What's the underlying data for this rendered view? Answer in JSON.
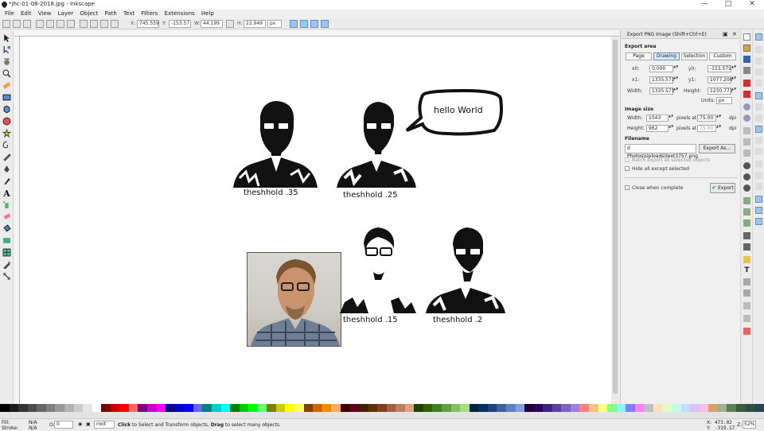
{
  "window": {
    "title": "*jhc-01-08-2018.jpg - Inkscape",
    "min": "—",
    "max": "□",
    "close": "✕"
  },
  "menu": [
    "File",
    "Edit",
    "View",
    "Layer",
    "Object",
    "Path",
    "Text",
    "Filters",
    "Extensions",
    "Help"
  ],
  "toolbar": {
    "x_label": "X:",
    "x_value": "745.559",
    "y_label": "Y:",
    "y_value": "-153.57",
    "w_label": "W:",
    "w_value": "44.199",
    "h_label": "H:",
    "h_value": "22.949",
    "unit": "px"
  },
  "canvas": {
    "labels": [
      "theshhold .35",
      "theshhold .25",
      "theshhold .15",
      "theshhold .2"
    ],
    "bubble_text": "hello World"
  },
  "export_dialog": {
    "title": "Export PNG Image (Shift+Ctrl+E)",
    "export_area_label": "Export area",
    "tabs": [
      "Page",
      "Drawing",
      "Selection",
      "Custom"
    ],
    "active_tab": "Drawing",
    "x0_label": "x0:",
    "x0": "0.000",
    "y0_label": "y0:",
    "y0": "-153.571",
    "x1_label": "x1:",
    "x1": "1335.571",
    "y1_label": "y1:",
    "y1": "1077.200",
    "width_label": "Width:",
    "width": "1335.571",
    "height_label": "Height:",
    "height": "1230.771",
    "units_label": "Units:",
    "units": "px",
    "image_size_label": "Image size",
    "img_width_label": "Width:",
    "img_width": "1043",
    "img_height_label": "Height:",
    "img_height": "962",
    "pixels_at": "pixels at",
    "dpi_value": "75.00",
    "dpi_value_disabled": "75.00",
    "dpi": "dpi",
    "filename_label": "Filename",
    "filename": "d Photos\\Uploads\\text3757.png",
    "export_as": "Export As...",
    "batch_label": "Batch export all selected objects",
    "hide_label": "Hide all except selected",
    "close_label": "Close when complete",
    "export_button": "Export"
  },
  "status": {
    "fill_label": "Fill:",
    "fill_value": "N/A",
    "stroke_label": "Stroke:",
    "stroke_value": "N/A",
    "opacity_label": "O:",
    "opacity_value": "0",
    "layer": "root",
    "message_bold1": "Click",
    "message1": " to Select and Transform objects, ",
    "message_bold2": "Drag",
    "message2": " to select many objects.",
    "cursor_x_label": "X:",
    "cursor_x": "473.02",
    "cursor_y_label": "Y:",
    "cursor_y": "-319.17",
    "zoom_label": "Z:",
    "zoom": "52%"
  },
  "accent_color": "#5b8fcf"
}
